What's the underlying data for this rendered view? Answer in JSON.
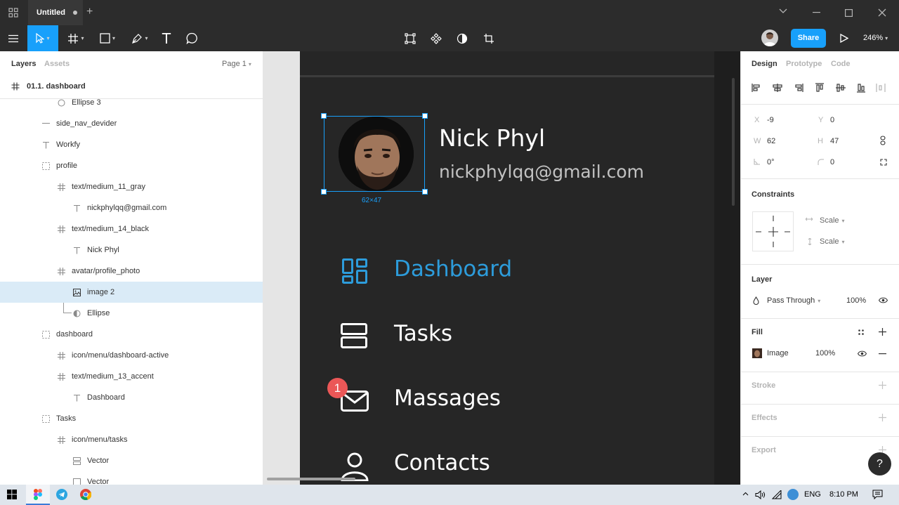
{
  "titlebar": {
    "tab_title": "Untitled",
    "new_tab": "+",
    "minimize": "⌄",
    "minimize2": "—",
    "maximize": "☐",
    "close": "✕"
  },
  "toolbar": {
    "text_tool": "T",
    "share_label": "Share",
    "zoom": "246%"
  },
  "left_panel": {
    "tab_layers": "Layers",
    "tab_assets": "Assets",
    "page_selector": "Page 1",
    "frame_name": "01.1. dashboard",
    "layers": [
      {
        "name": "Ellipse 3",
        "icon": "ellipse-icon"
      },
      {
        "name": "side_nav_devider",
        "icon": "line-icon"
      },
      {
        "name": "Workfy",
        "icon": "text-icon"
      },
      {
        "name": "profile",
        "icon": "group-icon"
      },
      {
        "name": "text/medium_11_gray",
        "icon": "frame-icon"
      },
      {
        "name": "nickphylqq@gmail.com",
        "icon": "text-icon"
      },
      {
        "name": "text/medium_14_black",
        "icon": "frame-icon"
      },
      {
        "name": "Nick Phyl",
        "icon": "text-icon"
      },
      {
        "name": "avatar/profile_photo",
        "icon": "frame-icon"
      },
      {
        "name": "image 2",
        "icon": "image-icon"
      },
      {
        "name": "Ellipse",
        "icon": "mask-icon"
      },
      {
        "name": "dashboard",
        "icon": "group-icon"
      },
      {
        "name": "icon/menu/dashboard-active",
        "icon": "frame-icon"
      },
      {
        "name": "text/medium_13_accent",
        "icon": "frame-icon"
      },
      {
        "name": "Dashboard",
        "icon": "text-icon"
      },
      {
        "name": "Tasks",
        "icon": "group-icon"
      },
      {
        "name": "icon/menu/tasks",
        "icon": "frame-icon"
      },
      {
        "name": "Vector",
        "icon": "vector-icon"
      },
      {
        "name": "Vector",
        "icon": "rect-icon"
      }
    ]
  },
  "canvas": {
    "profile_name": "Nick Phyl",
    "profile_email": "nickphylqq@gmail.com",
    "selection_size": "62×47",
    "nav": [
      {
        "label": "Dashboard",
        "icon": "dashboard-icon",
        "active": true
      },
      {
        "label": "Tasks",
        "icon": "tasks-icon",
        "active": false
      },
      {
        "label": "Massages",
        "icon": "mail-icon",
        "active": false,
        "badge": "1"
      },
      {
        "label": "Contacts",
        "icon": "contact-icon",
        "active": false
      }
    ],
    "accent_color": "#2d9cdb",
    "badge_color": "#eb5757"
  },
  "right_panel": {
    "tab_design": "Design",
    "tab_prototype": "Prototype",
    "tab_code": "Code",
    "x_label": "X",
    "x_value": "-9",
    "y_label": "Y",
    "y_value": "0",
    "w_label": "W",
    "w_value": "62",
    "h_label": "H",
    "h_value": "47",
    "rotation": "0°",
    "radius": "0",
    "constraints_title": "Constraints",
    "constraint_h": "Scale",
    "constraint_v": "Scale",
    "layer_title": "Layer",
    "blend_mode": "Pass Through",
    "layer_opacity": "100%",
    "fill_title": "Fill",
    "fill_type": "Image",
    "fill_opacity": "100%",
    "stroke_title": "Stroke",
    "effects_title": "Effects",
    "export_title": "Export",
    "help": "?"
  },
  "taskbar": {
    "lang": "ENG",
    "time": "8:10 PM"
  }
}
